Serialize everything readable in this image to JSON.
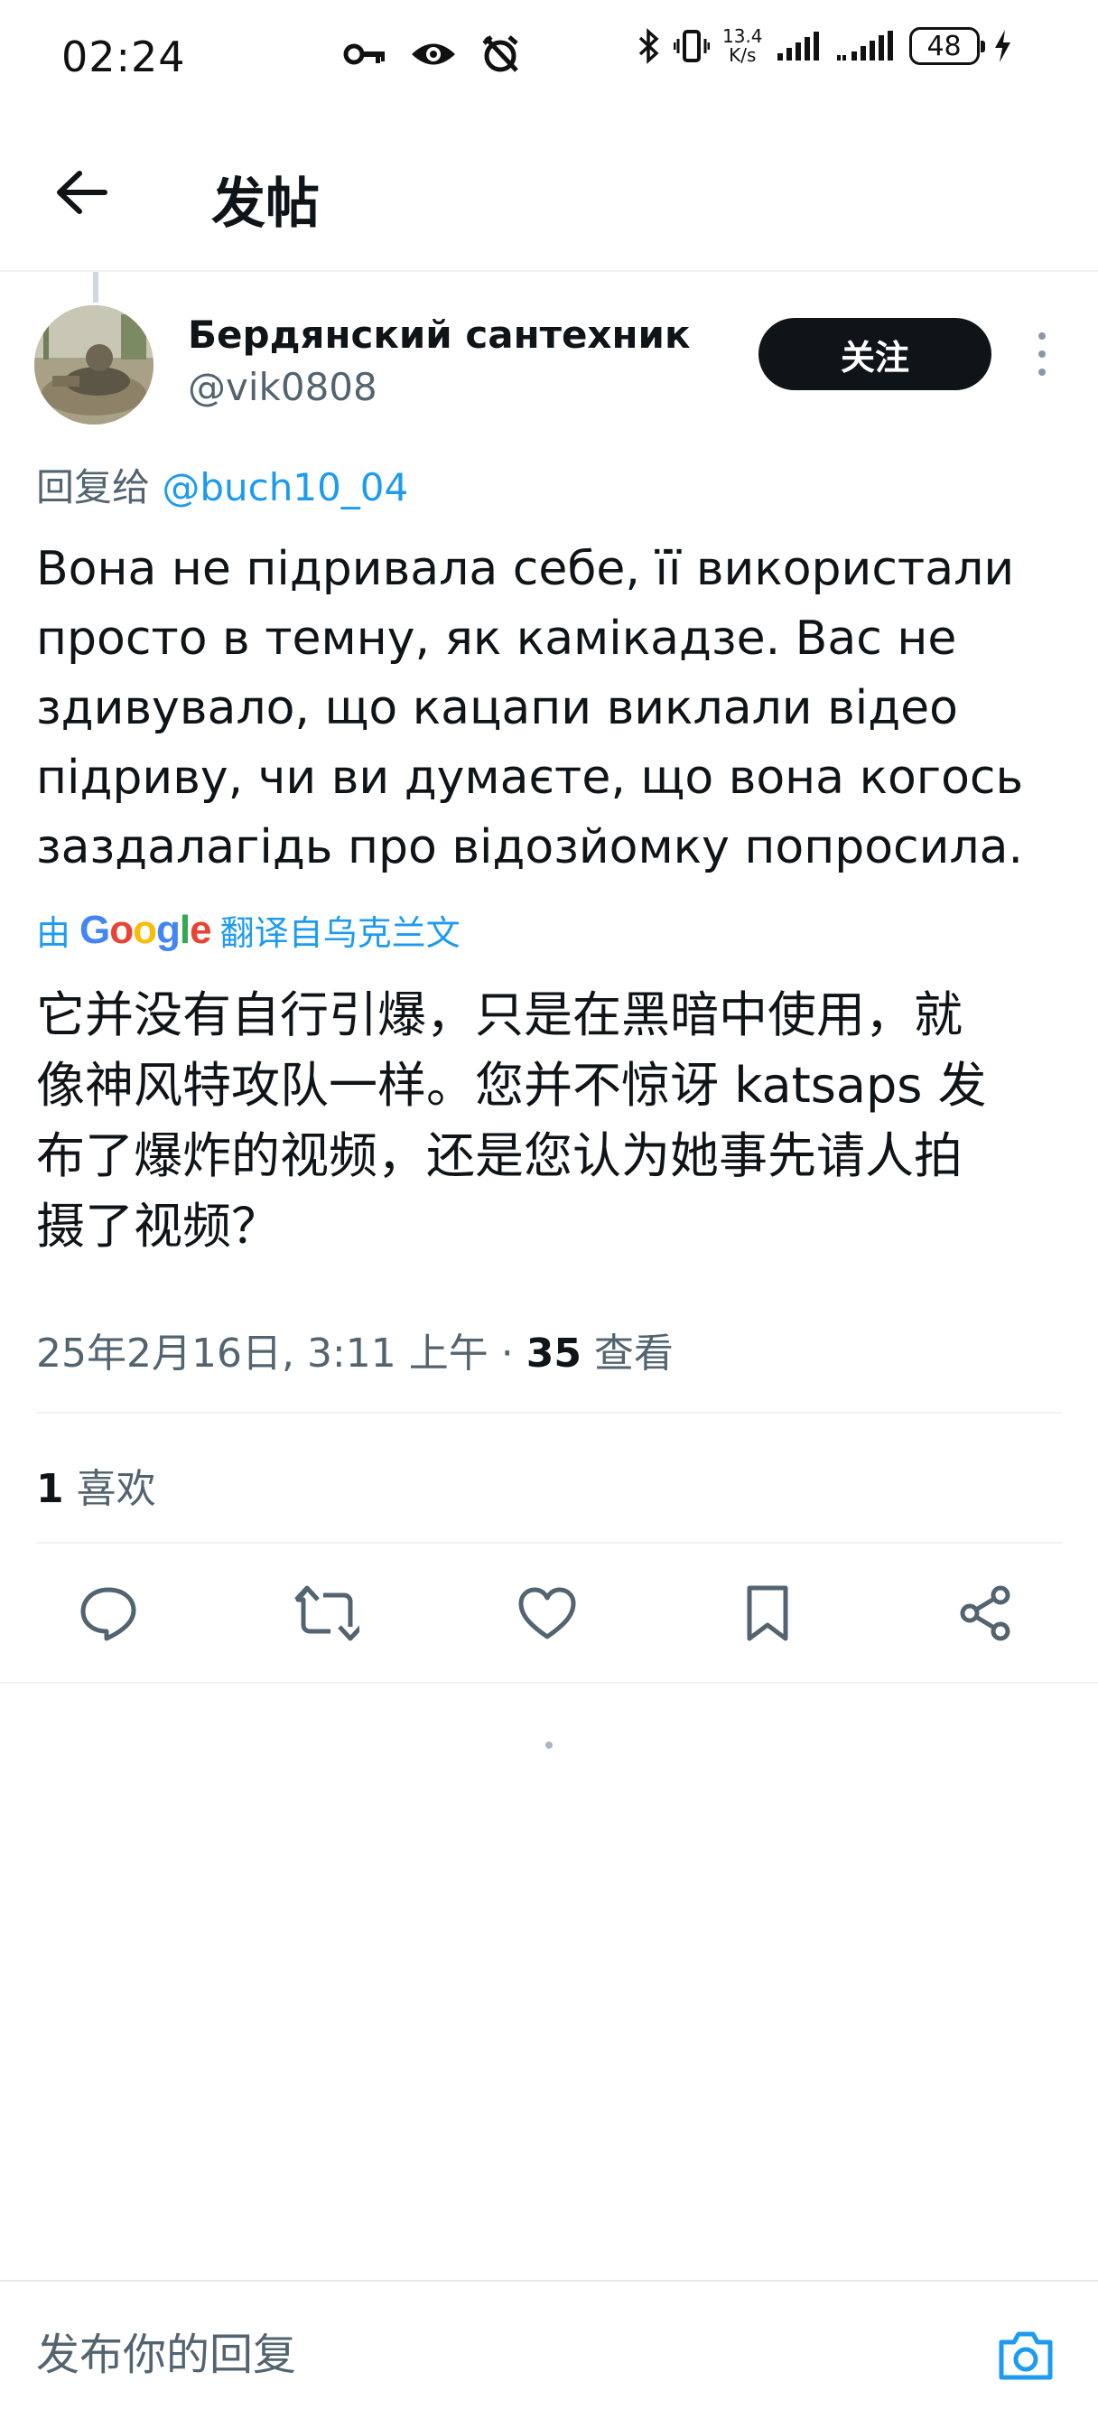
{
  "status_bar": {
    "time": "02:24",
    "net_speed_value": "13.4",
    "net_speed_unit": "K/s",
    "battery": "48",
    "icons": [
      "key-icon",
      "eye-icon",
      "alarm-off-icon",
      "bluetooth-icon",
      "vibrate-icon",
      "signal-icon",
      "signal-icon",
      "charging-icon"
    ]
  },
  "header": {
    "title": "发帖"
  },
  "post": {
    "author_name": "Бердянский сантехник",
    "author_handle": "@vik0808",
    "follow_label": "关注",
    "reply_to_prefix": "回复给",
    "reply_to_handle": "@buch10_04",
    "text": "Вона не підривала себе, її використали\nпросто в темну, як камікадзе. Вас не\nздивувало, що кацапи виклали відео\nпідриву, чи ви думаєте, що вона когось\nзаздалагідь про відозйомку попросила.",
    "translation_prefix": "由",
    "translation_brand": "Google",
    "translation_suffix": "翻译自乌克兰文",
    "translation": "它并没有自行引爆，只是在黑暗中使用，就\n像神风特攻队一样。您并不惊讶 katsaps 发\n布了爆炸的视频，还是您认为她事先请人拍\n摄了视频？",
    "timestamp": "25年2月16日, 3:11 上午 · ",
    "views_count": "35",
    "views_label": " 查看",
    "likes_count": "1",
    "likes_label": " 喜欢"
  },
  "actions": [
    {
      "name": "reply",
      "icon": "comment-icon"
    },
    {
      "name": "repost",
      "icon": "repost-icon"
    },
    {
      "name": "like",
      "icon": "heart-icon"
    },
    {
      "name": "bookmark",
      "icon": "bookmark-icon"
    },
    {
      "name": "share",
      "icon": "share-icon"
    }
  ],
  "reply_bar": {
    "placeholder": "发布你的回复",
    "camera_icon": "camera-icon"
  },
  "colors": {
    "accent": "#1d9bf0",
    "text_primary": "#0f1419",
    "text_secondary": "#536471",
    "follow_bg": "#0f1419"
  }
}
